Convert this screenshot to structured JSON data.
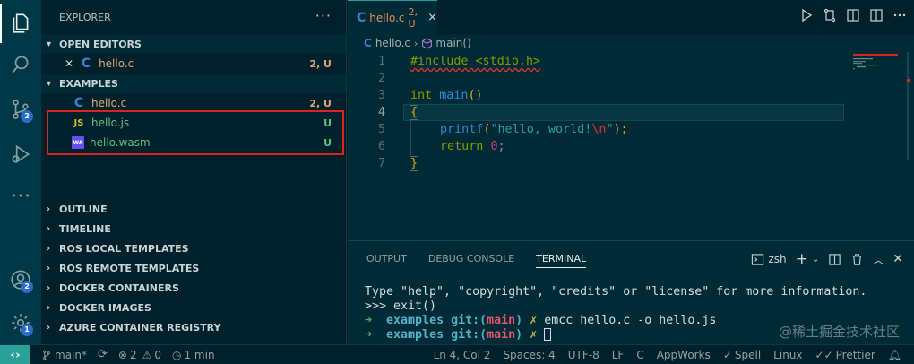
{
  "activity_bar": {
    "source_control_badge": "2",
    "accounts_badge": "2",
    "manage_badge": "1"
  },
  "sidebar": {
    "title": "EXPLORER",
    "more": "···",
    "open_editors": {
      "header": "OPEN EDITORS",
      "items": [
        {
          "icon": "C",
          "name": "hello.c",
          "status": "2, U"
        }
      ]
    },
    "examples": {
      "header": "EXAMPLES",
      "items": [
        {
          "icon": "C",
          "name": "hello.c",
          "status": "2, U"
        },
        {
          "icon": "JS",
          "name": "hello.js",
          "status": "U"
        },
        {
          "icon": "WA",
          "name": "hello.wasm",
          "status": "U"
        }
      ]
    },
    "collapsed_sections": [
      "OUTLINE",
      "TIMELINE",
      "ROS LOCAL TEMPLATES",
      "ROS REMOTE TEMPLATES",
      "DOCKER CONTAINERS",
      "DOCKER IMAGES",
      "AZURE CONTAINER REGISTRY"
    ]
  },
  "editor": {
    "tab": {
      "icon": "C",
      "name": "hello.c",
      "modified": "2, U",
      "close": "×"
    },
    "breadcrumb": {
      "file": "hello.c",
      "symbol": "main()"
    },
    "line_numbers": [
      "1",
      "2",
      "3",
      "4",
      "5",
      "6",
      "7"
    ],
    "code": {
      "l1": "#include <stdio.h>",
      "l3_kw": "int",
      "l3_fn": "main",
      "l3_paren": "()",
      "l4": "{",
      "l5_fn": "printf",
      "l5_open": "(",
      "l5_str1": "\"hello, world!",
      "l5_esc": "\\n",
      "l5_str2": "\"",
      "l5_close": ");",
      "l6_kw": "return",
      "l6_num": "0",
      "l6_semi": ";",
      "l7": "}"
    }
  },
  "panel": {
    "tabs": [
      "OUTPUT",
      "DEBUG CONSOLE",
      "TERMINAL"
    ],
    "shell": "zsh",
    "terminal": {
      "line1": "Type \"help\", \"copyright\", \"credits\" or \"license\" for more information.",
      "line2": ">>> exit()",
      "arrow": "➜",
      "dir": "examples",
      "git_prefix": "git:(",
      "branch": "main",
      "git_suffix": ")",
      "dirty": "✗",
      "command": "emcc hello.c -o hello.js"
    },
    "watermark": "@稀土掘金技术社区"
  },
  "status_bar": {
    "branch": "main*",
    "errors": "2",
    "warnings": "0",
    "time": "1 min",
    "position": "Ln 4, Col 2",
    "spaces": "Spaces: 4",
    "encoding": "UTF-8",
    "eol": "LF",
    "language": "C",
    "appworks": "AppWorks",
    "spell": "Spell",
    "platform": "Linux",
    "prettier": "Prettier"
  },
  "colors": {
    "background": "#00212b",
    "editor_bg": "#002b36",
    "accent": "#2aa198",
    "highlight_box": "#d9231f"
  }
}
